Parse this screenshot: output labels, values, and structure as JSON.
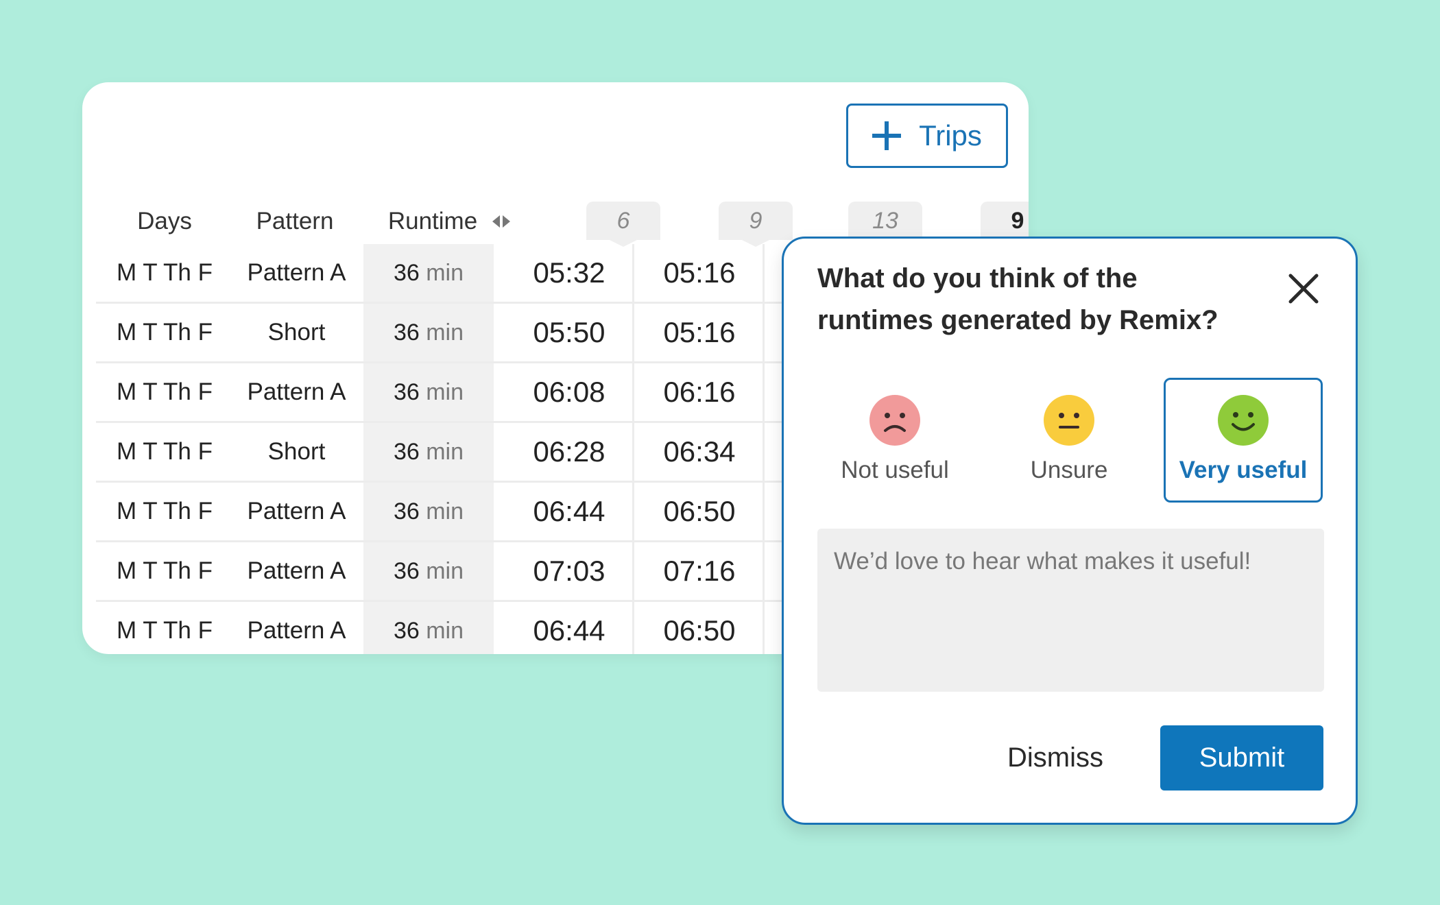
{
  "toolbar": {
    "add_trips_label": "Trips"
  },
  "table": {
    "headers": {
      "days": "Days",
      "pattern": "Pattern",
      "runtime": "Runtime"
    },
    "trip_columns": [
      "6",
      "9",
      "13",
      "9"
    ],
    "rows": [
      {
        "days": "M T Th F",
        "pattern": "Pattern A",
        "runtime": "36",
        "unit": "min",
        "t1": "05:32",
        "t2": "05:16"
      },
      {
        "days": "M T Th F",
        "pattern": "Short",
        "runtime": "36",
        "unit": "min",
        "t1": "05:50",
        "t2": "05:16"
      },
      {
        "days": "M T Th F",
        "pattern": "Pattern A",
        "runtime": "36",
        "unit": "min",
        "t1": "06:08",
        "t2": "06:16"
      },
      {
        "days": "M T Th F",
        "pattern": "Short",
        "runtime": "36",
        "unit": "min",
        "t1": "06:28",
        "t2": "06:34"
      },
      {
        "days": "M T Th F",
        "pattern": "Pattern A",
        "runtime": "36",
        "unit": "min",
        "t1": "06:44",
        "t2": "06:50"
      },
      {
        "days": "M T Th F",
        "pattern": "Pattern A",
        "runtime": "36",
        "unit": "min",
        "t1": "07:03",
        "t2": "07:16"
      },
      {
        "days": "M T Th F",
        "pattern": "Pattern A",
        "runtime": "36",
        "unit": "min",
        "t1": "06:44",
        "t2": "06:50"
      }
    ]
  },
  "dialog": {
    "title_line1": "What do you think of the",
    "title_line2": "runtimes generated by Remix?",
    "options": [
      {
        "label": "Not useful",
        "icon": "frown-face-icon",
        "color": "#f19a9a",
        "selected": false
      },
      {
        "label": "Unsure",
        "icon": "neutral-face-icon",
        "color": "#f9cc3d",
        "selected": false
      },
      {
        "label": "Very useful",
        "icon": "smile-face-icon",
        "color": "#8fcb3a",
        "selected": true
      }
    ],
    "comment_placeholder": "We’d love to hear what makes it useful!",
    "comment_value": "",
    "dismiss_label": "Dismiss",
    "submit_label": "Submit"
  },
  "colors": {
    "background": "#afeddc",
    "accent": "#1a73b5",
    "submit": "#0f76bb"
  }
}
